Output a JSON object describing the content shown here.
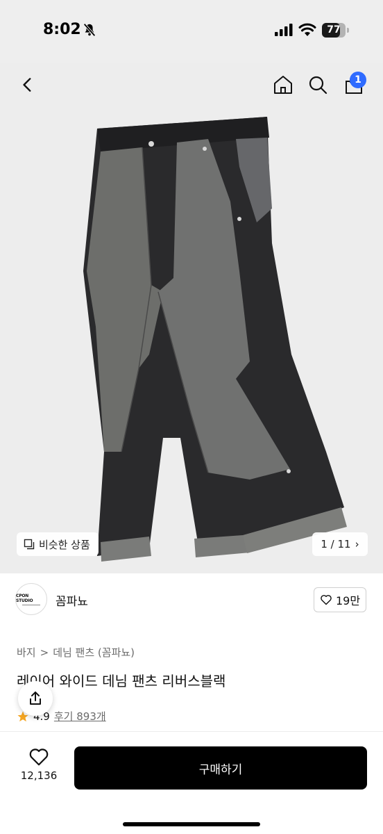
{
  "status_bar": {
    "time": "8:02",
    "battery_level": "77",
    "battery_fraction": 0.77
  },
  "top_nav": {
    "cart_count": "1"
  },
  "hero": {
    "similar_label": "비슷한 상품",
    "page_indicator": "1 / 11",
    "page_chevron": "›"
  },
  "brand": {
    "logo_text": "CPON STUDIO",
    "name": "꼼파뇨",
    "likes": "19만"
  },
  "breadcrumb": {
    "level1": "바지",
    "separator": ">",
    "level2": "데님 팬츠 (꼼파뇨)"
  },
  "product": {
    "title": "레이어 와이드 데님 팬츠 리버스블랙",
    "rating": "4.9",
    "review_label": "후기 893개"
  },
  "bottom_bar": {
    "wish_count": "12,136",
    "buy_label": "구매하기"
  },
  "colors": {
    "accent_badge": "#2f6bff",
    "star": "#f5a623",
    "buy_button": "#000000",
    "hero_background": "#ededed"
  },
  "icons": [
    "back-icon",
    "home-icon",
    "search-icon",
    "cart-icon",
    "similar-icon",
    "heart-icon",
    "share-icon",
    "star-icon"
  ]
}
